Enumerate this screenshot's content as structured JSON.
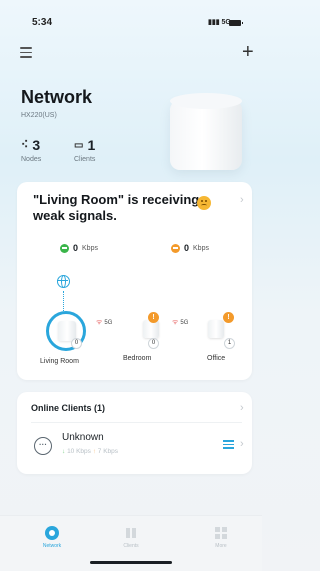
{
  "status_bar": {
    "time": "5:34",
    "network": "5G"
  },
  "header": {
    "title": "Network",
    "model": "HX220(US)"
  },
  "stats": {
    "nodes": {
      "value": "3",
      "label": "Nodes"
    },
    "clients": {
      "value": "1",
      "label": "Clients"
    }
  },
  "signal_card": {
    "title": "\"Living Room\" is receiving weak signals.",
    "upload": {
      "value": "0",
      "unit": "Kbps"
    },
    "download": {
      "value": "0",
      "unit": "Kbps"
    }
  },
  "mesh": {
    "nodes": [
      {
        "label": "Living Room",
        "clients": "0",
        "warning": ""
      },
      {
        "label": "Bedroom",
        "clients": "0",
        "warning": "!",
        "band": "5G"
      },
      {
        "label": "Office",
        "clients": "1",
        "warning": "!",
        "band": "5G"
      }
    ]
  },
  "online_clients": {
    "title": "Online Clients (1)",
    "items": [
      {
        "name": "Unknown",
        "up": "10 Kbps",
        "down": "7 Kbps"
      }
    ]
  },
  "tabs": [
    {
      "label": "Network",
      "active": true
    },
    {
      "label": "Clients",
      "active": false
    },
    {
      "label": "More",
      "active": false
    }
  ],
  "colors": {
    "accent": "#2aa6dc",
    "upload": "#3ab54a",
    "download": "#f39a2b",
    "warning": "#f39a2b"
  }
}
